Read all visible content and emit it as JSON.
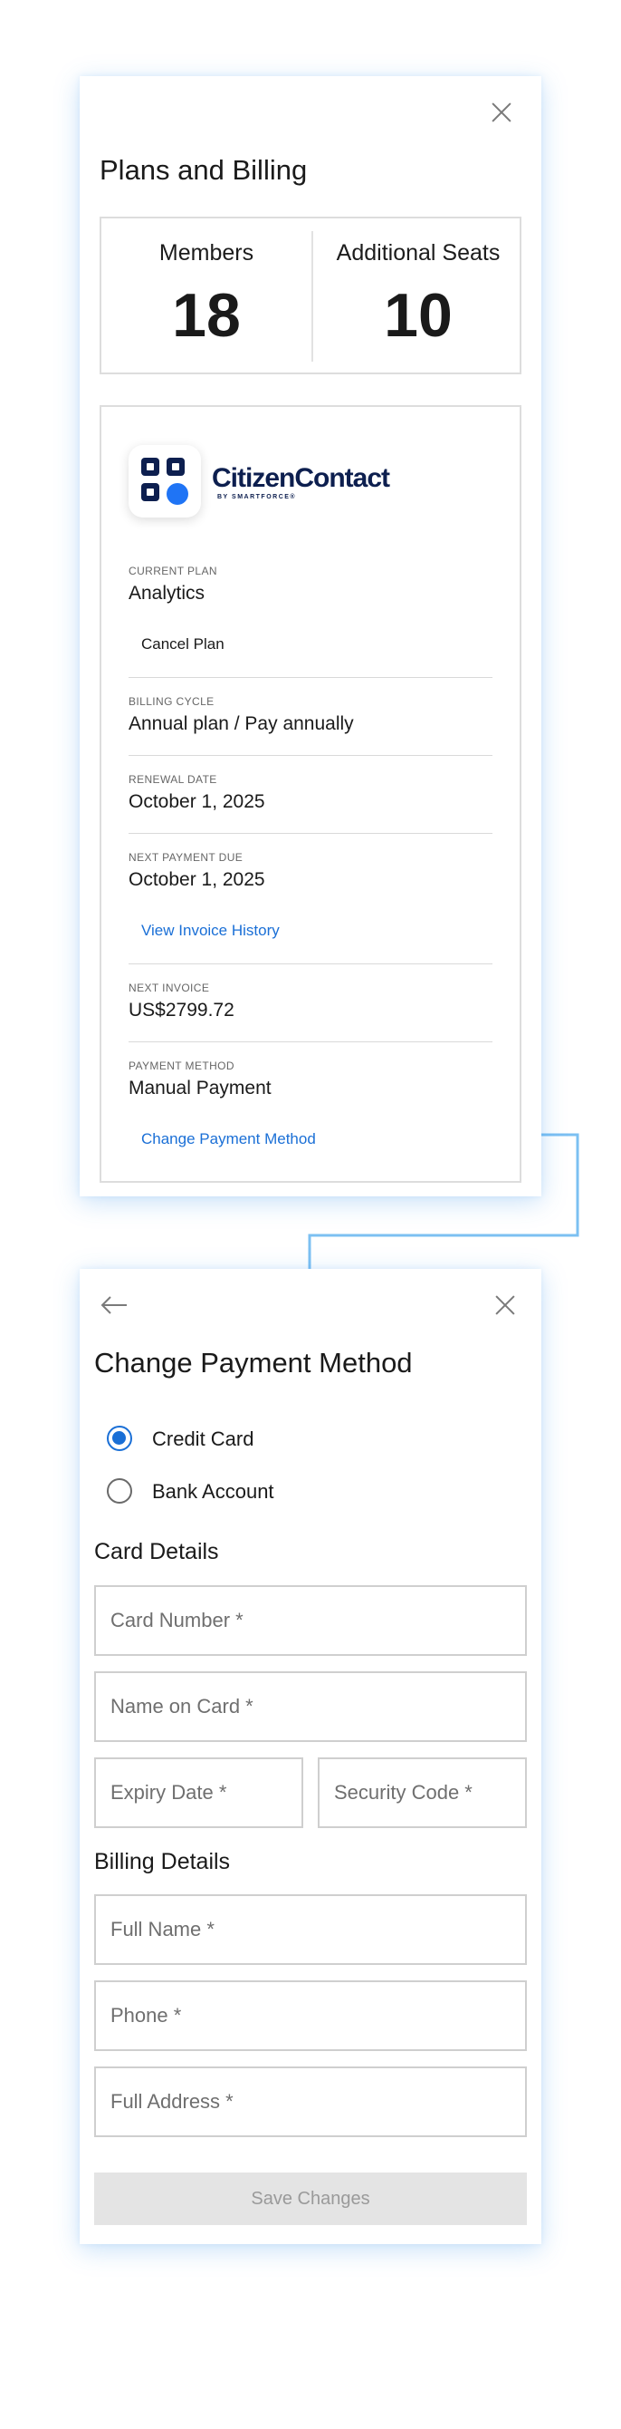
{
  "billing": {
    "title": "Plans and Billing",
    "stats": [
      {
        "label": "Members",
        "value": "18"
      },
      {
        "label": "Additional Seats",
        "value": "10"
      }
    ],
    "brand": {
      "name": "CitizenContact",
      "byline": "BY SMARTFORCE®",
      "accent": "#1f74f5",
      "primary": "#0d1f4f"
    },
    "current_plan": {
      "label": "CURRENT PLAN",
      "value": "Analytics",
      "action": "Cancel Plan"
    },
    "billing_cycle": {
      "label": "BILLING CYCLE",
      "value": "Annual plan / Pay annually"
    },
    "renewal_date": {
      "label": "RENEWAL DATE",
      "value": "October 1, 2025"
    },
    "next_payment": {
      "label": "NEXT PAYMENT DUE",
      "value": "October 1, 2025",
      "action": "View Invoice History"
    },
    "next_invoice": {
      "label": "NEXT INVOICE",
      "value": "US$2799.72"
    },
    "payment_method": {
      "label": "PAYMENT METHOD",
      "value": "Manual Payment",
      "action": "Change Payment Method"
    }
  },
  "payment": {
    "title": "Change Payment Method",
    "options": [
      {
        "label": "Credit Card",
        "selected": true
      },
      {
        "label": "Bank Account",
        "selected": false
      }
    ],
    "card_details": {
      "title": "Card Details",
      "card_number_placeholder": "Card Number *",
      "name_on_card_placeholder": "Name on Card *",
      "expiry_placeholder": "Expiry Date *",
      "security_code_placeholder": "Security Code *"
    },
    "billing_details": {
      "title": "Billing Details",
      "full_name_placeholder": "Full Name *",
      "phone_placeholder": "Phone *",
      "address_placeholder": "Full Address *"
    },
    "save_label": "Save Changes"
  },
  "colors": {
    "link": "#1a6fd6",
    "connector": "#7cc0f2",
    "disabled_bg": "#e4e4e4"
  }
}
